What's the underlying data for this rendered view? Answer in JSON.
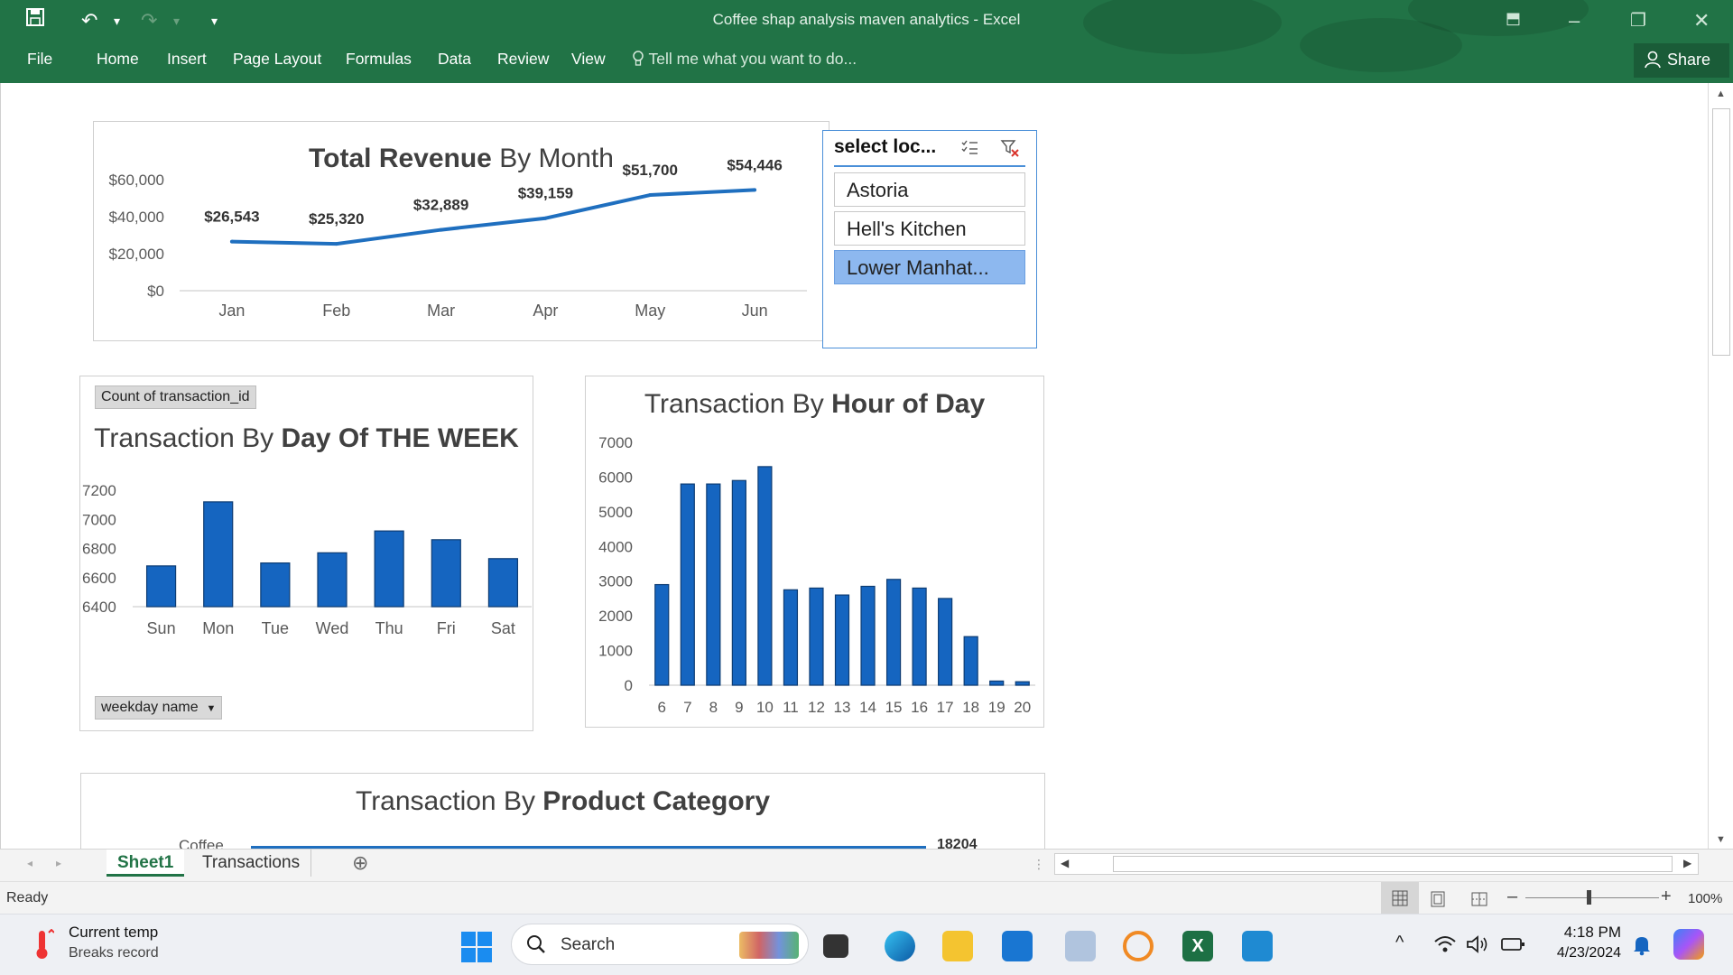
{
  "window": {
    "title": "Coffee shap analysis maven analytics - Excel",
    "min_glyph": "–",
    "restore_glyph": "❐",
    "close_glyph": "✕",
    "ribbon_glyph": "⬒"
  },
  "qat": {
    "undo_glyph": "↶",
    "redo_glyph": "↷",
    "dropdown_glyph": "▾",
    "customize_glyph": "▾"
  },
  "ribbon": {
    "tabs": [
      "File",
      "Home",
      "Insert",
      "Page Layout",
      "Formulas",
      "Data",
      "Review",
      "View"
    ],
    "tell_me": "Tell me what you want to do...",
    "share": "Share"
  },
  "revenue_chart": {
    "title_normal": " By Month",
    "title_bold": "Total Revenue",
    "chart_data": {
      "type": "line",
      "categories": [
        "Jan",
        "Feb",
        "Mar",
        "Apr",
        "May",
        "Jun"
      ],
      "values": [
        26543,
        25320,
        32889,
        39159,
        51700,
        54446
      ],
      "data_labels": [
        "$26,543",
        "$25,320",
        "$32,889",
        "$39,159",
        "$51,700",
        "$54,446"
      ],
      "y_ticks": [
        "$0",
        "$20,000",
        "$40,000",
        "$60,000"
      ],
      "ylim": [
        0,
        60000
      ],
      "color": "#1f6fbf"
    }
  },
  "slicer": {
    "title": "select loc...",
    "items": [
      {
        "label": "Astoria",
        "selected": false
      },
      {
        "label": "Hell's Kitchen",
        "selected": false
      },
      {
        "label": "Lower Manhat...",
        "selected": true
      }
    ]
  },
  "weekday_chart": {
    "field_button": "Count of transaction_id",
    "title_normal": "Transaction By ",
    "title_bold": "Day Of THE WEEK",
    "axis_button": "weekday name",
    "chart_data": {
      "type": "bar",
      "categories": [
        "Sun",
        "Mon",
        "Tue",
        "Wed",
        "Thu",
        "Fri",
        "Sat"
      ],
      "values": [
        6680,
        7120,
        6700,
        6770,
        6920,
        6860,
        6730
      ],
      "y_ticks": [
        "6400",
        "6600",
        "6800",
        "7000",
        "7200"
      ],
      "ylim": [
        6400,
        7200
      ],
      "color": "#1565c0"
    }
  },
  "hour_chart": {
    "title_normal": "Transaction By ",
    "title_bold": "Hour of Day",
    "chart_data": {
      "type": "bar",
      "categories": [
        "6",
        "7",
        "8",
        "9",
        "10",
        "11",
        "12",
        "13",
        "14",
        "15",
        "16",
        "17",
        "18",
        "19",
        "20"
      ],
      "values": [
        2900,
        5800,
        5800,
        5900,
        6300,
        2750,
        2800,
        2600,
        2850,
        3050,
        2800,
        2500,
        1400,
        120,
        100
      ],
      "y_ticks": [
        "0",
        "1000",
        "2000",
        "3000",
        "4000",
        "5000",
        "6000",
        "7000"
      ],
      "ylim": [
        0,
        7000
      ],
      "color": "#1565c0"
    }
  },
  "category_chart": {
    "title_normal": "Transaction By ",
    "title_bold": "Product Category",
    "partial_label": "Coffee",
    "partial_value": "18204"
  },
  "sheet_tabs": {
    "tabs": [
      "Sheet1",
      "Transactions"
    ],
    "active": "Sheet1",
    "add_glyph": "⊕"
  },
  "status": {
    "ready": "Ready",
    "zoom": "100%"
  },
  "taskbar": {
    "weather_title": "Current temp",
    "weather_sub": "Breaks record",
    "search": "Search",
    "time": "4:18 PM",
    "date": "4/23/2024",
    "chevron_glyph": "^"
  }
}
